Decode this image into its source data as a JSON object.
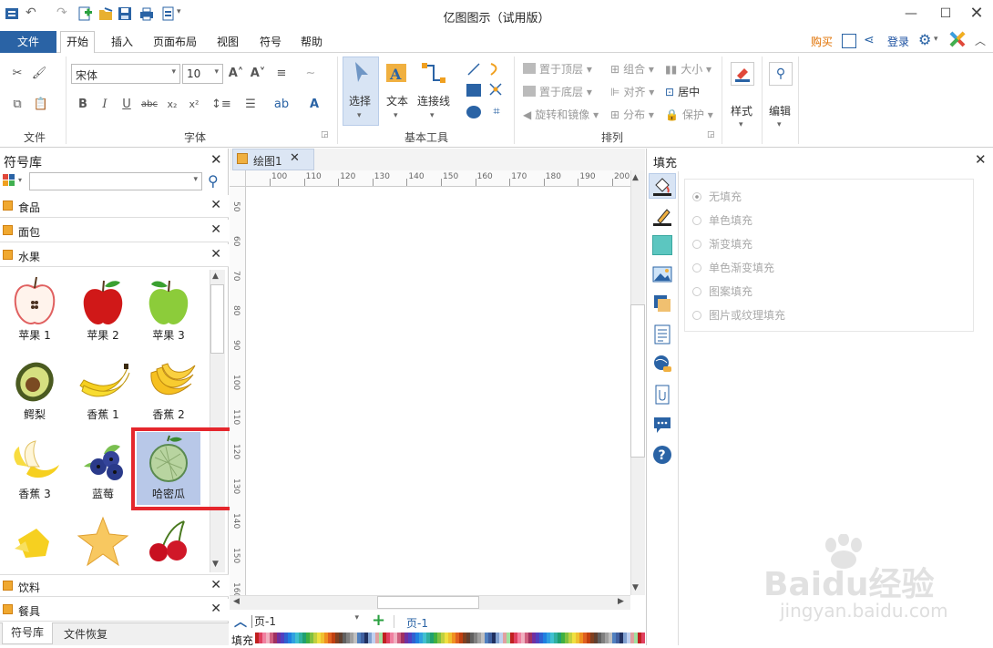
{
  "app": {
    "title": "亿图图示（试用版）"
  },
  "menu": {
    "file": "文件",
    "tabs": [
      "开始",
      "插入",
      "页面布局",
      "视图",
      "符号",
      "帮助"
    ],
    "buy": "购买",
    "login": "登录"
  },
  "ribbon": {
    "groups": {
      "file": "文件",
      "font": "字体",
      "basic_tools": "基本工具",
      "arrange": "排列"
    },
    "font_name": "宋体",
    "font_size": "10",
    "tools": {
      "select": "选择",
      "text": "文本",
      "connector": "连接线"
    },
    "arrange": {
      "bring_front": "置于顶层",
      "send_back": "置于底层",
      "rotate_mirror": "旋转和镜像",
      "group": "组合",
      "align": "对齐",
      "distribute": "分布",
      "size": "大小",
      "center": "居中",
      "protect": "保护"
    },
    "style": "样式",
    "edit": "编辑"
  },
  "library": {
    "title": "符号库",
    "categories": [
      "食品",
      "面包",
      "水果"
    ],
    "fruits": [
      {
        "label": "苹果 1",
        "icon": "apple-cut-icon"
      },
      {
        "label": "苹果 2",
        "icon": "red-apple-icon"
      },
      {
        "label": "苹果 3",
        "icon": "green-apple-icon"
      },
      {
        "label": "鳄梨",
        "icon": "avocado-icon"
      },
      {
        "label": "香蕉 1",
        "icon": "banana-icon"
      },
      {
        "label": "香蕉 2",
        "icon": "banana-bunch-icon"
      },
      {
        "label": "香蕉 3",
        "icon": "peeled-banana-icon"
      },
      {
        "label": "蓝莓",
        "icon": "blueberry-icon"
      },
      {
        "label": "哈密瓜",
        "icon": "melon-icon"
      }
    ],
    "bottom_categories": [
      "饮料",
      "餐具"
    ],
    "bottom_tabs": [
      "符号库",
      "文件恢复"
    ]
  },
  "canvas": {
    "doc_tab": "绘图1",
    "hruler": [
      "100",
      "110",
      "120",
      "130",
      "140",
      "150",
      "160",
      "170",
      "180",
      "190",
      "200"
    ],
    "vruler": [
      "50",
      "60",
      "70",
      "80",
      "90",
      "100",
      "110",
      "120",
      "130",
      "140",
      "150",
      "160"
    ],
    "page_select": "页-1",
    "page_tab": "页-1",
    "fill_label": "填充"
  },
  "fill_panel": {
    "title": "填充",
    "options": [
      "无填充",
      "单色填充",
      "渐变填充",
      "单色渐变填充",
      "图案填充",
      "图片或纹理填充"
    ]
  },
  "watermark": {
    "brand": "Baidu经验",
    "url": "jingyan.baidu.com"
  }
}
